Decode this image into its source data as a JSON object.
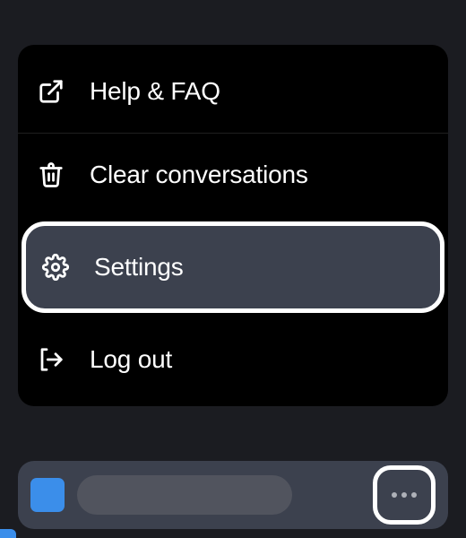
{
  "menu": {
    "items": [
      {
        "label": "Help & FAQ",
        "icon": "external-link-icon",
        "interactable": true,
        "highlighted": false
      },
      {
        "label": "Clear conversations",
        "icon": "trash-icon",
        "interactable": true,
        "highlighted": false
      },
      {
        "label": "Settings",
        "icon": "gear-icon",
        "interactable": true,
        "highlighted": true
      },
      {
        "label": "Log out",
        "icon": "logout-icon",
        "interactable": true,
        "highlighted": false
      }
    ]
  },
  "bottomBar": {
    "avatarColor": "#3b8eea",
    "moreButtonHighlighted": true
  }
}
